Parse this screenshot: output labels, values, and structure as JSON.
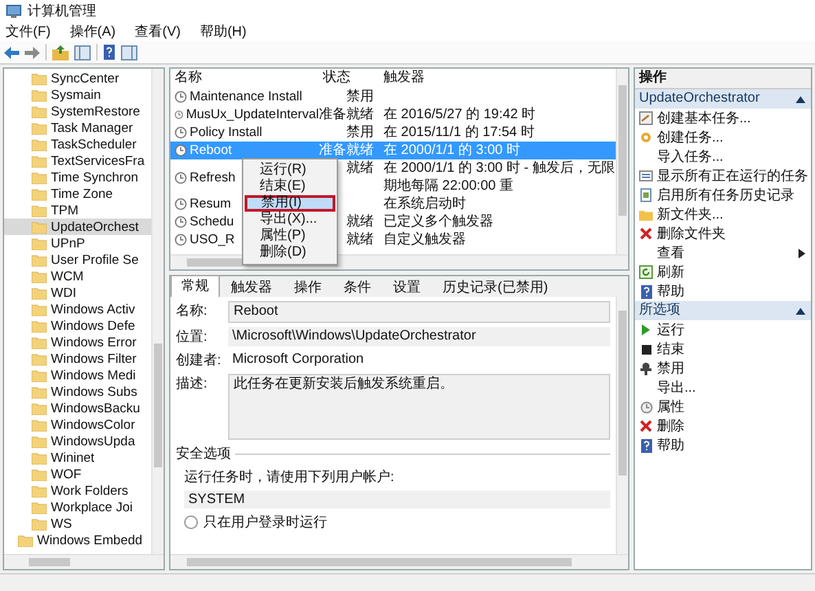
{
  "window": {
    "title": "计算机管理"
  },
  "menu": [
    "文件(F)",
    "操作(A)",
    "查看(V)",
    "帮助(H)"
  ],
  "tree": {
    "items": [
      {
        "label": "SyncCenter",
        "selected": false
      },
      {
        "label": "Sysmain",
        "selected": false
      },
      {
        "label": "SystemRestore",
        "selected": false
      },
      {
        "label": "Task Manager",
        "selected": false
      },
      {
        "label": "TaskScheduler",
        "selected": false
      },
      {
        "label": "TextServicesFra",
        "selected": false
      },
      {
        "label": "Time Synchron",
        "selected": false
      },
      {
        "label": "Time Zone",
        "selected": false
      },
      {
        "label": "TPM",
        "selected": false
      },
      {
        "label": "UpdateOrchest",
        "selected": true
      },
      {
        "label": "UPnP",
        "selected": false
      },
      {
        "label": "User Profile Se",
        "selected": false
      },
      {
        "label": "WCM",
        "selected": false
      },
      {
        "label": "WDI",
        "selected": false
      },
      {
        "label": "Windows Activ",
        "selected": false
      },
      {
        "label": "Windows Defe",
        "selected": false
      },
      {
        "label": "Windows Error",
        "selected": false
      },
      {
        "label": "Windows Filter",
        "selected": false
      },
      {
        "label": "Windows Medi",
        "selected": false
      },
      {
        "label": "Windows Subs",
        "selected": false
      },
      {
        "label": "WindowsBacku",
        "selected": false
      },
      {
        "label": "WindowsColor",
        "selected": false
      },
      {
        "label": "WindowsUpda",
        "selected": false
      },
      {
        "label": "Wininet",
        "selected": false
      },
      {
        "label": "WOF",
        "selected": false
      },
      {
        "label": "Work Folders",
        "selected": false
      },
      {
        "label": "Workplace Joi",
        "selected": false
      },
      {
        "label": "WS",
        "selected": false
      }
    ],
    "parent_level_items": [
      {
        "label": "Windows Embedd",
        "selected": false
      }
    ]
  },
  "task_list": {
    "columns": [
      "名称",
      "状态",
      "触发器"
    ],
    "rows": [
      {
        "name": "Maintenance Install",
        "status": "禁用",
        "selected": false
      },
      {
        "name": "MusUx_UpdateInterval",
        "status": "准备就绪",
        "trigger": "在 2016/5/27 的 19:42 时",
        "selected": false
      },
      {
        "name": "Policy Install",
        "status": "禁用",
        "trigger": "在 2015/11/1 的 17:54 时",
        "selected": false
      },
      {
        "name": "Reboot",
        "status": "准备就绪",
        "trigger": "在 2000/1/1 的 3:00 时",
        "selected": true
      },
      {
        "name": "Refresh",
        "status": "就绪",
        "trigger": "在 2000/1/1 的 3:00 时 - 触发后，无限期地每隔 22:00:00 重",
        "selected": false
      },
      {
        "name": "Resum",
        "trigger": "在系统启动时",
        "selected": false
      },
      {
        "name": "Schedu",
        "status": "就绪",
        "trigger": "已定义多个触发器",
        "selected": false
      },
      {
        "name": "USO_R",
        "status": "就绪",
        "trigger": "自定义触发器",
        "selected": false
      }
    ]
  },
  "context_menu": {
    "items": [
      {
        "label": "运行(R)",
        "selected": false
      },
      {
        "label": "结束(E)",
        "selected": false
      },
      {
        "label": "禁用(I)",
        "selected": true
      },
      {
        "label": "导出(X)...",
        "selected": false
      },
      {
        "label": "属性(P)",
        "selected": false
      },
      {
        "label": "删除(D)",
        "selected": false
      }
    ]
  },
  "details": {
    "tabs": [
      {
        "label": "常规",
        "selected": true
      },
      {
        "label": "触发器",
        "selected": false
      },
      {
        "label": "操作",
        "selected": false
      },
      {
        "label": "条件",
        "selected": false
      },
      {
        "label": "设置",
        "selected": false
      },
      {
        "label": "历史记录(已禁用)",
        "selected": false
      }
    ],
    "fields": [
      {
        "label": "名称:",
        "value": "Reboot",
        "kind": "box"
      },
      {
        "label": "位置:",
        "value": "\\Microsoft\\Windows\\UpdateOrchestrator",
        "kind": "shaded"
      },
      {
        "label": "创建者:",
        "value": "Microsoft Corporation",
        "kind": "plain"
      },
      {
        "label": "描述:",
        "value": "此任务在更新安装后触发系统重启。",
        "kind": "area"
      }
    ],
    "security": {
      "title": "安全选项",
      "prompt": "运行任务时，请使用下列用户帐户:",
      "account": "SYSTEM",
      "options": [
        {
          "label": "只在用户登录时运行",
          "selected": false
        }
      ]
    }
  },
  "actions": {
    "header": "操作",
    "sections": [
      {
        "title": "UpdateOrchestrator",
        "expanded": true,
        "items": [
          {
            "label": "创建基本任务...",
            "kind": "wizard"
          },
          {
            "label": "创建任务...",
            "kind": "task"
          },
          {
            "label": "导入任务...",
            "kind": "none"
          },
          {
            "label": "显示所有正在运行的任务",
            "kind": "list"
          },
          {
            "label": "启用所有任务历史记录",
            "kind": "history"
          },
          {
            "label": "新文件夹...",
            "kind": "folder"
          },
          {
            "label": "删除文件夹",
            "kind": "delete"
          },
          {
            "label": "查看",
            "kind": "submenu"
          },
          {
            "label": "刷新",
            "kind": "refresh"
          },
          {
            "label": "帮助",
            "kind": "help"
          }
        ]
      },
      {
        "title": "所选项",
        "expanded": true,
        "items": [
          {
            "label": "运行",
            "kind": "run"
          },
          {
            "label": "结束",
            "kind": "stop"
          },
          {
            "label": "禁用",
            "kind": "disable"
          },
          {
            "label": "导出...",
            "kind": "none"
          },
          {
            "label": "属性",
            "kind": "properties"
          },
          {
            "label": "删除",
            "kind": "delete"
          },
          {
            "label": "帮助",
            "kind": "help"
          }
        ]
      }
    ]
  }
}
